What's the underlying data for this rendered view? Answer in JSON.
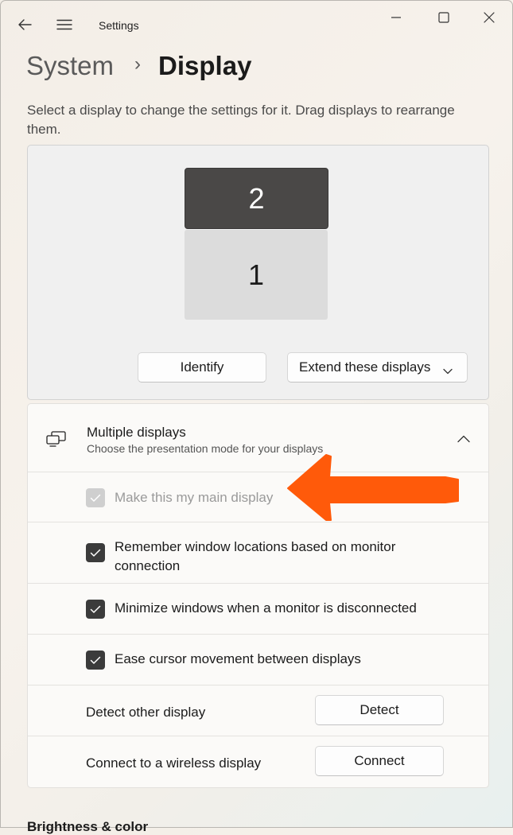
{
  "window": {
    "title": "Settings",
    "icons": {
      "back": "back-arrow-icon",
      "menu": "hamburger-menu-icon",
      "minimize": "minimize-icon",
      "maximize": "maximize-icon",
      "close": "close-icon"
    }
  },
  "breadcrumb": {
    "parent": "System",
    "separator": "›",
    "current": "Display"
  },
  "intro_text": "Select a display to change the settings for it. Drag displays to rearrange them.",
  "arrangement": {
    "monitors": [
      {
        "label": "2",
        "state": "selected"
      },
      {
        "label": "1",
        "state": "normal"
      }
    ],
    "identify_label": "Identify",
    "mode_select": {
      "value": "Extend these displays",
      "icon": "chevron-down-icon"
    }
  },
  "multiple_displays": {
    "icon": "multiple-displays-icon",
    "title": "Multiple displays",
    "subtitle": "Choose the presentation mode for your displays",
    "expanded": true,
    "options": [
      {
        "label": "Make this my main display",
        "checked": true,
        "disabled": true
      },
      {
        "label": "Remember window locations based on monitor connection",
        "checked": true,
        "disabled": false
      },
      {
        "label": "Minimize windows when a monitor is disconnected",
        "checked": true,
        "disabled": false
      },
      {
        "label": "Ease cursor movement between displays",
        "checked": true,
        "disabled": false
      }
    ],
    "detect": {
      "label": "Detect other display",
      "button": "Detect"
    },
    "connect": {
      "label": "Connect to a wireless display",
      "button": "Connect"
    }
  },
  "annotation": {
    "color": "#ff5a0a",
    "shape": "arrow-pointing-left"
  },
  "next_section_heading": "Brightness & color"
}
